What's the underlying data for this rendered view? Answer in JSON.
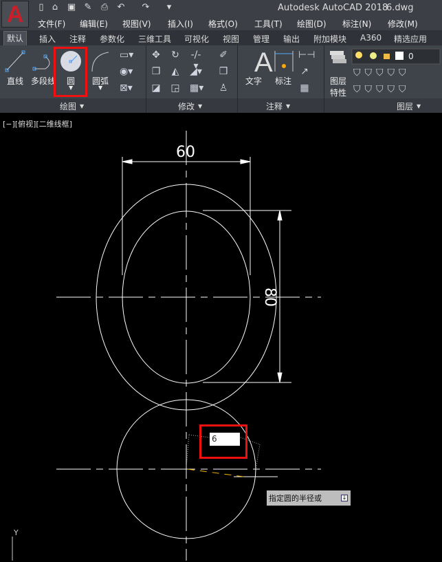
{
  "app": {
    "title": "Autodesk AutoCAD 2018",
    "file": "6.dwg",
    "logo": "A"
  },
  "menu": [
    "文件(F)",
    "编辑(E)",
    "视图(V)",
    "插入(I)",
    "格式(O)",
    "工具(T)",
    "绘图(D)",
    "标注(N)",
    "修改(M)"
  ],
  "tabs": [
    "默认",
    "插入",
    "注释",
    "参数化",
    "三维工具",
    "可视化",
    "视图",
    "管理",
    "输出",
    "附加模块",
    "A360",
    "精选应用"
  ],
  "ribbon": {
    "draw": {
      "title": "绘图",
      "line": "直线",
      "polyline": "多段线",
      "circle": "圆",
      "arc": "圆弧"
    },
    "modify": {
      "title": "修改"
    },
    "annotate": {
      "title": "注释",
      "text": "文字",
      "dimension": "标注"
    },
    "layers": {
      "title": "图层",
      "properties": "图层\n特性",
      "properties_l1": "图层",
      "properties_l2": "特性",
      "current_layer": "0"
    }
  },
  "viewport": {
    "label": "[−][俯视][二维线框]",
    "dim_horizontal": "60",
    "dim_vertical": "80",
    "axis": "Y"
  },
  "input": {
    "value": "6",
    "prompt": "指定圆的半径或"
  }
}
